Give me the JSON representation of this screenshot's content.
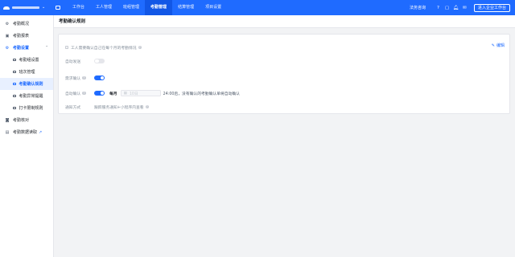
{
  "topbar": {
    "nav": [
      "工作台",
      "工人管理",
      "班组管理",
      "考勤管理",
      "结算管理",
      "项目设置"
    ],
    "active_nav": "考勤管理",
    "consult": "法务咨询",
    "enter_button": "进入企业工作台",
    "colors": {
      "bar": "#1f6bff",
      "active": "#1257e6"
    }
  },
  "sidebar": {
    "items": [
      {
        "label": "考勤概况",
        "icon": "gear-icon"
      },
      {
        "label": "考勤报表",
        "icon": "report-icon"
      },
      {
        "label": "考勤设置",
        "icon": "settings-icon"
      }
    ],
    "sub_items": [
      {
        "label": "考勤组设置"
      },
      {
        "label": "班次管理"
      },
      {
        "label": "考勤确认规则"
      },
      {
        "label": "考勤异常提醒"
      },
      {
        "label": "打卡限制规则"
      }
    ],
    "bottom_items": [
      {
        "label": "考勤核对",
        "icon": "check-icon"
      },
      {
        "label": "考勤数据读取",
        "icon": "data-icon"
      }
    ]
  },
  "page": {
    "title": "考勤确认规则",
    "edit_label": "编辑",
    "rule_check": "工人需要确认自己在每个月的考勤情况",
    "rows": [
      {
        "label": "自动发送",
        "state": "off"
      },
      {
        "label": "需求确认",
        "state": "on"
      },
      {
        "label": "自动确认",
        "state": "on"
      }
    ],
    "every": "每月",
    "date_placeholder": "10日",
    "after_text": "24:00后，没有确认的考勤确认单将自动确认",
    "notify_label": "通知方式",
    "notify_value": "跟踪服务通知+小程序内查看"
  }
}
